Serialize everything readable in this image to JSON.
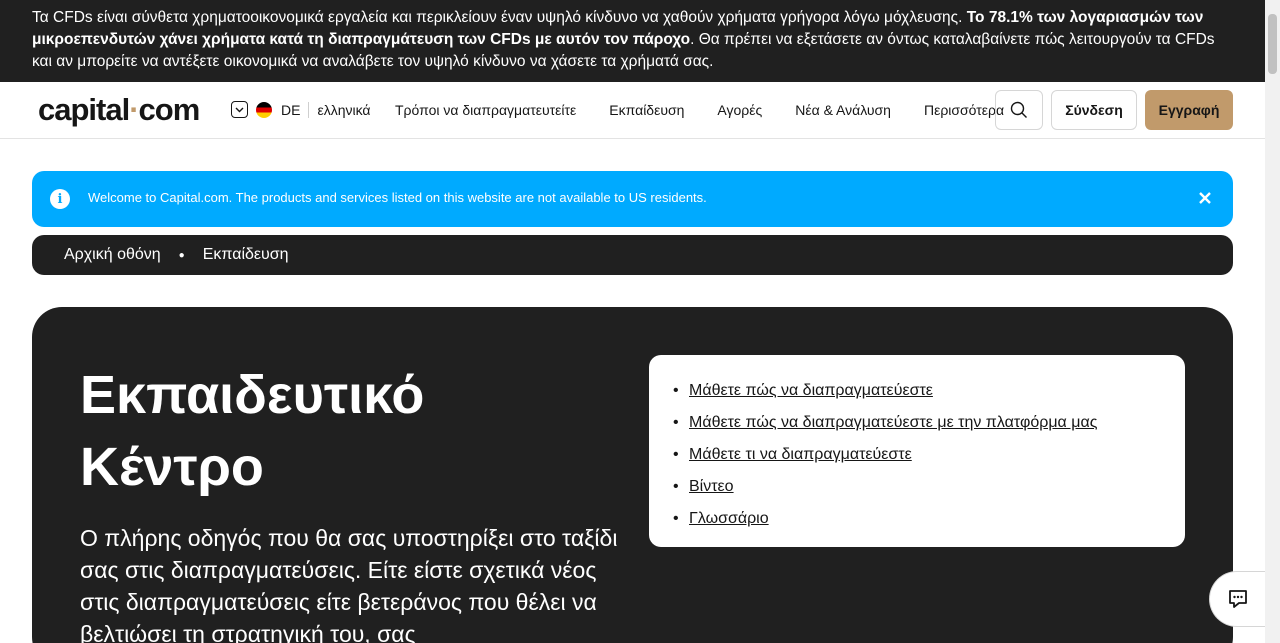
{
  "risk_banner": {
    "text_normal_1": "Τα CFDs είναι σύνθετα χρηματοοικονομικά εργαλεία και περικλείουν έναν υψηλό κίνδυνο να χαθούν χρήματα γρήγορα λόγω μόχλευσης. ",
    "text_bold": "Το 78.1% των λογαριασμών των μικροεπενδυτών χάνει χρήματα κατά τη διαπραγμάτευση των CFDs με αυτόν τον πάροχο",
    "text_normal_2": ". Θα πρέπει να εξετάσετε αν όντως καταλαβαίνετε πώς λειτουργούν τα CFDs και αν μπορείτε να αντέξετε οικονομικά να αναλάβετε τον υψηλό κίνδυνο να χάσετε τα χρήματά σας."
  },
  "header": {
    "logo_part1": "capital",
    "logo_dot": "·",
    "logo_part2": "com",
    "language": {
      "country_code": "DE",
      "language_label": "ελληνικά"
    },
    "nav": [
      "Τρόποι να διαπραγματευτείτε",
      "Εκπαίδευση",
      "Αγορές",
      "Νέα & Ανάλυση",
      "Περισσότερα"
    ],
    "login_label": "Σύνδεση",
    "signup_label": "Εγγραφή"
  },
  "notice": {
    "message": "Welcome to Capital.com. The products and services listed on this website are not available to US residents.",
    "icon": "info-icon",
    "close_icon": "close-icon"
  },
  "breadcrumb": {
    "home": "Αρχική οθόνη",
    "current": "Εκπαίδευση"
  },
  "hero": {
    "title": "Εκπαιδευτικό Κέντρο",
    "description": "Ο πλήρης οδηγός που θα σας υποστηρίξει στο ταξίδι σας στις διαπραγματεύσεις. Είτε είστε σχετικά νέος στις διαπραγματεύσεις είτε βετεράνος που θέλει να βελτιώσει τη στρατηγική του, σας",
    "links": [
      "Μάθετε πώς να διαπραγματεύεστε",
      "Μάθετε πώς να διαπραγματεύεστε με την πλατφόρμα μας",
      "Μάθετε τι να διαπραγματεύεστε",
      "Βίντεο",
      "Γλωσσάριο"
    ]
  },
  "colors": {
    "brand_accent": "#c19a6b",
    "notice_bg": "#00aaff",
    "dark_bg": "#202020"
  }
}
